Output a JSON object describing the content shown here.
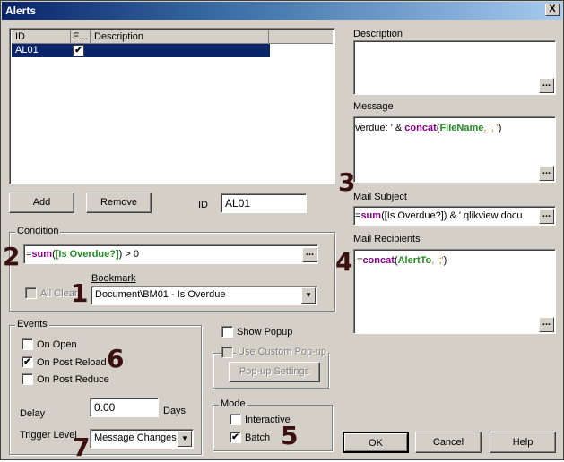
{
  "window": {
    "title": "Alerts",
    "close_glyph": "X"
  },
  "alerts_list": {
    "columns": [
      "ID",
      "E...",
      "Description"
    ],
    "rows": [
      {
        "id": "AL01",
        "enabled": true,
        "description": ""
      }
    ]
  },
  "buttons": {
    "add": "Add",
    "remove": "Remove",
    "ok": "OK",
    "cancel": "Cancel",
    "help": "Help",
    "popup_settings": "Pop-up Settings"
  },
  "id_field": {
    "label": "ID",
    "value": "AL01"
  },
  "condition": {
    "group_label": "Condition",
    "expr_prefix": "=",
    "expr_fn": "sum",
    "expr_open": "(",
    "expr_field": "[Is Overdue?]",
    "expr_rest": ")  > 0",
    "all_clear_label": "All Clear",
    "bookmark_label": "Bookmark",
    "bookmark_value": "Document\\BM01 - Is Overdue"
  },
  "description": {
    "label": "Description",
    "value": ""
  },
  "message": {
    "label": "Message",
    "p1": "verdue: ' & ",
    "p2": "concat",
    "p3": "(",
    "p4": "FileName",
    "p5": ", ', '",
    "p6": ")"
  },
  "mail_subject": {
    "label": "Mail Subject",
    "p1": "=",
    "p2": "sum",
    "p3": "([Is Overdue?]) & ' qlikview docu"
  },
  "mail_recipients": {
    "label": "Mail Recipients",
    "p1": "=",
    "p2": "concat",
    "p3": "(",
    "p4": "AlertTo",
    "p5": ", ';'",
    "p6": ")"
  },
  "events": {
    "group_label": "Events",
    "on_open": {
      "label": "On Open",
      "checked": false
    },
    "on_post_reload": {
      "label": "On Post Reload",
      "checked": true
    },
    "on_post_reduce": {
      "label": "On Post Reduce",
      "checked": false
    },
    "delay_label": "Delay",
    "delay_value": "0.00",
    "days_label": "Days",
    "trigger_label": "Trigger Level",
    "trigger_value": "Message Changes"
  },
  "popup": {
    "show_popup": {
      "label": "Show Popup",
      "checked": false
    },
    "use_custom": {
      "label": "Use Custom Pop-up",
      "checked": false
    }
  },
  "mode": {
    "group_label": "Mode",
    "interactive": {
      "label": "Interactive",
      "checked": false
    },
    "batch": {
      "label": "Batch",
      "checked": true
    }
  },
  "annotations": [
    "1",
    "2",
    "3",
    "4",
    "5",
    "6",
    "7"
  ],
  "check_glyph": "✔",
  "ellipsis_glyph": "...",
  "dropdown_glyph": "▼",
  "colors": {
    "selection": "#0a246a",
    "keyword": "#8b008b",
    "field": "#228b22",
    "string": "#cc6600"
  }
}
